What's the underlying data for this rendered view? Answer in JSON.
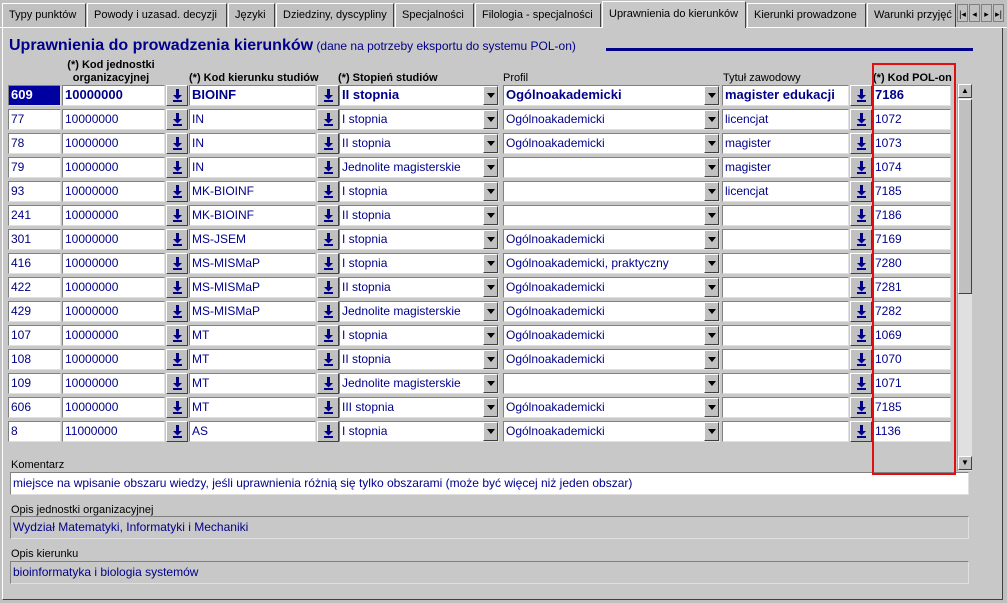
{
  "tabs": [
    {
      "label": "Typy punktów",
      "active": false
    },
    {
      "label": "Powody i uzasad. decyzji",
      "active": false
    },
    {
      "label": "Języki",
      "active": false
    },
    {
      "label": "Dziedziny, dyscypliny",
      "active": false
    },
    {
      "label": "Specjalności",
      "active": false
    },
    {
      "label": "Filologia - specjalności",
      "active": false
    },
    {
      "label": "Uprawnienia do kierunków",
      "active": true
    },
    {
      "label": "Kierunki prowadzone",
      "active": false
    },
    {
      "label": "Warunki przyjęć",
      "active": false
    }
  ],
  "tab_scroll": {
    "first": "|◂",
    "prev": "◂",
    "next": "▸",
    "last": "▸|"
  },
  "header": {
    "title": "Uprawnienia do prowadzenia kierunków",
    "subtitle": "(dane na potrzeby eksportu do systemu POL-on)"
  },
  "columns": {
    "kod_jedn": "(*) Kod jednostki organizacyjnej",
    "kod_jedn_line1": "(*) Kod jednostki",
    "kod_jedn_line2": "organizacyjnej",
    "kod_kier": "(*) Kod kierunku studiów",
    "stopien": "(*) Stopień studiów",
    "profil": "Profil",
    "tytul": "Tytuł zawodowy",
    "kod_polon": "(*) Kod POL-on"
  },
  "rows": [
    {
      "id": "609",
      "jedn": "10000000",
      "kier": "BIOINF",
      "stopien": "II stopnia",
      "profil": "Ogólnoakademicki",
      "tytul": "magister edukacji",
      "polon": "7186"
    },
    {
      "id": "77",
      "jedn": "10000000",
      "kier": "IN",
      "stopien": "I stopnia",
      "profil": "Ogólnoakademicki",
      "tytul": "licencjat",
      "polon": "1072"
    },
    {
      "id": "78",
      "jedn": "10000000",
      "kier": "IN",
      "stopien": "II stopnia",
      "profil": "Ogólnoakademicki",
      "tytul": "magister",
      "polon": "1073"
    },
    {
      "id": "79",
      "jedn": "10000000",
      "kier": "IN",
      "stopien": "Jednolite magisterskie",
      "profil": "",
      "tytul": "magister",
      "polon": "1074"
    },
    {
      "id": "93",
      "jedn": "10000000",
      "kier": "MK-BIOINF",
      "stopien": "I stopnia",
      "profil": "",
      "tytul": "licencjat",
      "polon": "7185"
    },
    {
      "id": "241",
      "jedn": "10000000",
      "kier": "MK-BIOINF",
      "stopien": "II stopnia",
      "profil": "",
      "tytul": "",
      "polon": "7186"
    },
    {
      "id": "301",
      "jedn": "10000000",
      "kier": "MS-JSEM",
      "stopien": "I stopnia",
      "profil": "Ogólnoakademicki",
      "tytul": "",
      "polon": "7169"
    },
    {
      "id": "416",
      "jedn": "10000000",
      "kier": "MS-MISMaP",
      "stopien": "I stopnia",
      "profil": "Ogólnoakademicki, praktyczny",
      "tytul": "",
      "polon": "7280"
    },
    {
      "id": "422",
      "jedn": "10000000",
      "kier": "MS-MISMaP",
      "stopien": "II stopnia",
      "profil": "Ogólnoakademicki",
      "tytul": "",
      "polon": "7281"
    },
    {
      "id": "429",
      "jedn": "10000000",
      "kier": "MS-MISMaP",
      "stopien": "Jednolite magisterskie",
      "profil": "Ogólnoakademicki",
      "tytul": "",
      "polon": "7282"
    },
    {
      "id": "107",
      "jedn": "10000000",
      "kier": "MT",
      "stopien": "I stopnia",
      "profil": "Ogólnoakademicki",
      "tytul": "",
      "polon": "1069"
    },
    {
      "id": "108",
      "jedn": "10000000",
      "kier": "MT",
      "stopien": "II stopnia",
      "profil": "Ogólnoakademicki",
      "tytul": "",
      "polon": "1070"
    },
    {
      "id": "109",
      "jedn": "10000000",
      "kier": "MT",
      "stopien": "Jednolite magisterskie",
      "profil": "",
      "tytul": "",
      "polon": "1071"
    },
    {
      "id": "606",
      "jedn": "10000000",
      "kier": "MT",
      "stopien": "III stopnia",
      "profil": "Ogólnoakademicki",
      "tytul": "",
      "polon": "7185"
    },
    {
      "id": "8",
      "jedn": "11000000",
      "kier": "AS",
      "stopien": "I stopnia",
      "profil": "Ogólnoakademicki",
      "tytul": "",
      "polon": "1136"
    }
  ],
  "komentarz": {
    "label": "Komentarz",
    "value": "miejsce na wpisanie obszaru wiedzy, jeśli uprawnienia różnią się tylko obszarami (może być więcej niż jeden obszar)"
  },
  "opis_jedn": {
    "label": "Opis jednostki organizacyjnej",
    "value": "Wydział Matematyki, Informatyki i Mechaniki"
  },
  "opis_kier": {
    "label": "Opis kierunku",
    "value": "bioinformatyka i biologia systemów"
  },
  "colors": {
    "accent": "#00008b",
    "highlight_border": "#e01010",
    "selection": "#0000a0"
  }
}
